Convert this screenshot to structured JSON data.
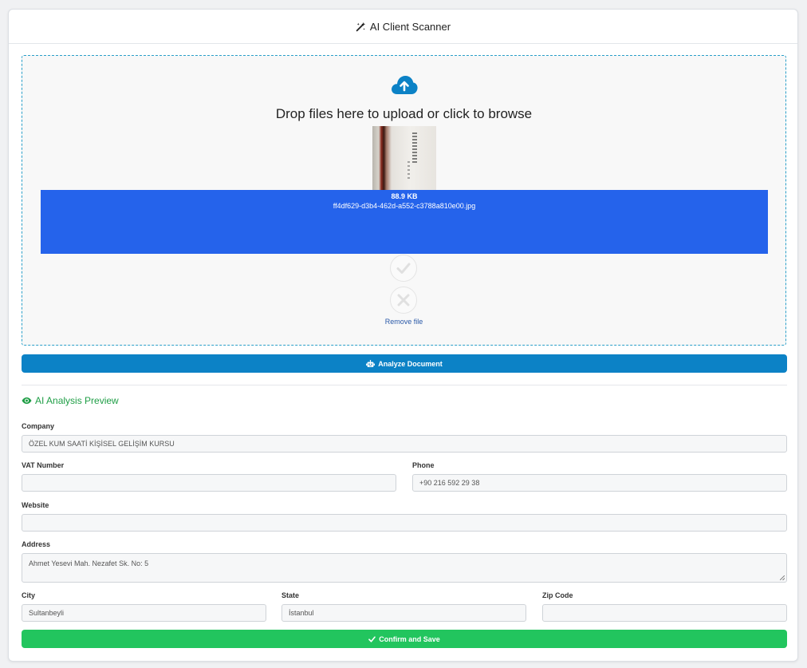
{
  "header": {
    "title": "AI Client Scanner",
    "icon": "magic-wand-icon"
  },
  "dropzone": {
    "message": "Drop files here to upload or click to browse",
    "file": {
      "size": "88.9 KB",
      "name": "ff4df629-d3b4-462d-a552-c3788a810e00.jpg"
    },
    "remove_label": "Remove file"
  },
  "analyze_button": {
    "label": "Analyze Document"
  },
  "preview": {
    "title": "AI Analysis Preview"
  },
  "form": {
    "company": {
      "label": "Company",
      "value": "ÖZEL KUM SAATİ KİŞİSEL GELİŞİM KURSU"
    },
    "vat": {
      "label": "VAT Number",
      "value": ""
    },
    "phone": {
      "label": "Phone",
      "value": "+90 216 592 29 38"
    },
    "website": {
      "label": "Website",
      "value": ""
    },
    "address": {
      "label": "Address",
      "value": "Ahmet Yesevi Mah. Nezafet Sk. No: 5"
    },
    "city": {
      "label": "City",
      "value": "Sultanbeyli"
    },
    "state": {
      "label": "State",
      "value": "İstanbul"
    },
    "zip": {
      "label": "Zip Code",
      "value": ""
    }
  },
  "save_button": {
    "label": "Confirm and Save"
  },
  "colors": {
    "analyze": "#0c82c6",
    "save": "#22c55e",
    "file_details": "#2563eb",
    "preview_title": "#1f9e46"
  }
}
